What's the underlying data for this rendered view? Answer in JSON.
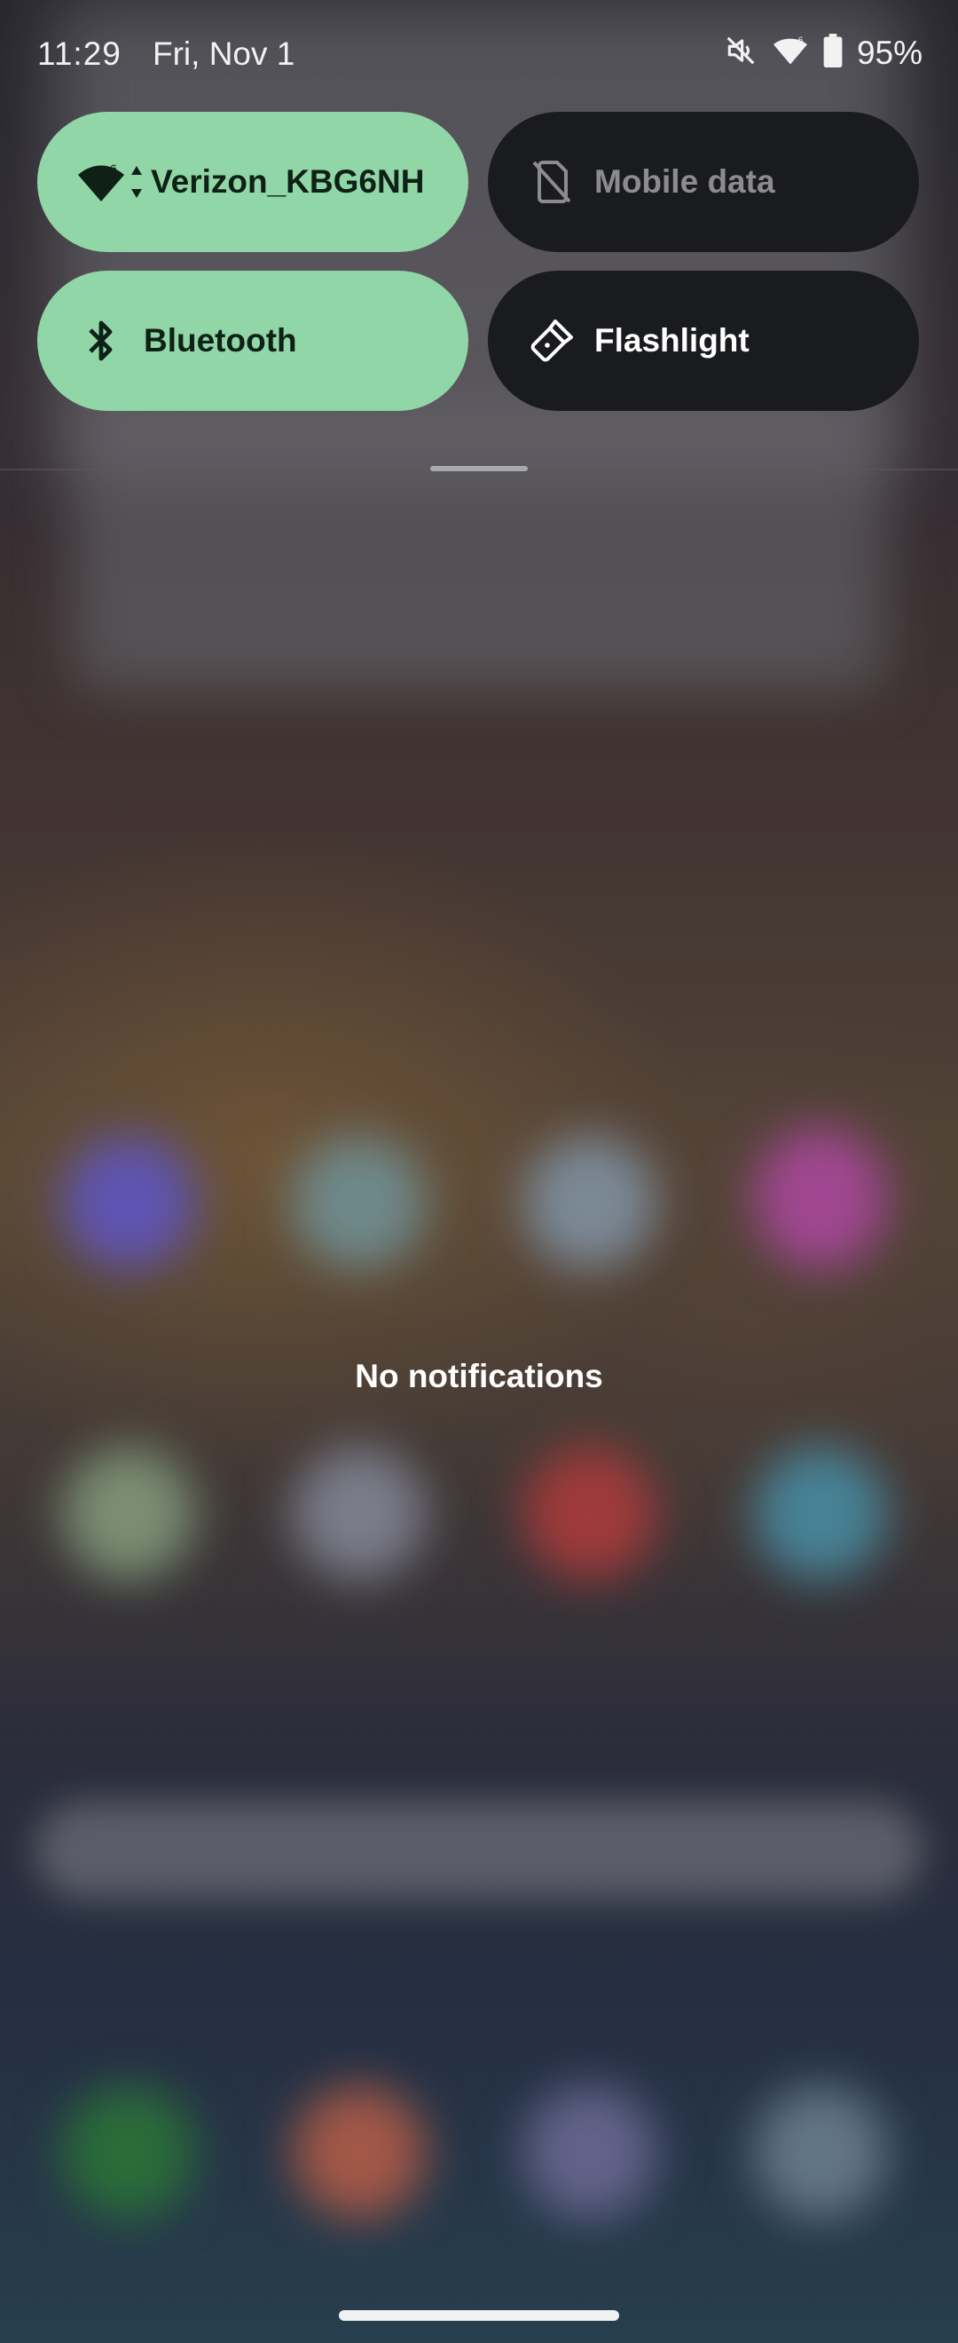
{
  "status_bar": {
    "time": "11:29",
    "date": "Fri, Nov 1",
    "battery": "95%",
    "icons": [
      "mute-icon",
      "wifi-icon",
      "battery-icon"
    ]
  },
  "quick_tiles": [
    {
      "label": "Verizon_KBG6NH",
      "state": "on",
      "icon": "wifi-6-icon"
    },
    {
      "label": "Mobile data",
      "state": "off",
      "icon": "no-sim-icon"
    },
    {
      "label": "Bluetooth",
      "state": "on",
      "icon": "bluetooth-icon"
    },
    {
      "label": "Flashlight",
      "state": "off",
      "icon": "flashlight-icon"
    }
  ],
  "notifications": {
    "empty_text": "No notifications"
  },
  "colors": {
    "tile_on": "#91d6a6",
    "tile_off": "#1a1b1f",
    "text_light": "#ffffff"
  }
}
